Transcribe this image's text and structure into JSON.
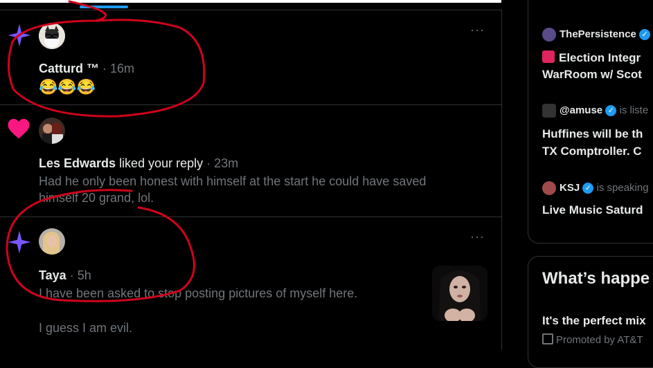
{
  "notifications": [
    {
      "type": "post",
      "name": "Catturd ™",
      "time": "16m",
      "text": "😂😂😂"
    },
    {
      "type": "like",
      "name": "Les Edwards",
      "action": "liked your reply",
      "time": "23m",
      "text_line1": "Had he only been honest with himself at the start he could have saved",
      "text_line2": "himself 20 grand, lol."
    },
    {
      "type": "post",
      "name": "Taya",
      "time": "5h",
      "text_line1": "I have been asked to stop posting pictures of myself here.",
      "text_line2": "I guess I am evil."
    }
  ],
  "more_label": "···",
  "dot_sep": "·",
  "spaces": {
    "item1_host": "ThePersistence",
    "item1_title_line1": "Election Integr",
    "item1_title_line2": "WarRoom w/ Scot",
    "item2_host": "@amuse",
    "item2_status": "is liste",
    "item2_title_line1": "Huffines will be th",
    "item2_title_line2": "TX Comptroller.  C",
    "item3_host": "KSJ",
    "item3_status": "is speaking",
    "item3_title": "Live Music Saturd"
  },
  "trending": {
    "heading": "What’s happe",
    "promo_title": "It's the perfect mix",
    "promo_by": "Promoted by AT&T"
  },
  "colors": {
    "accent": "#1d9bf0",
    "annotation": "#d0021b",
    "star": "#7856ff",
    "heart": "#f91880"
  }
}
